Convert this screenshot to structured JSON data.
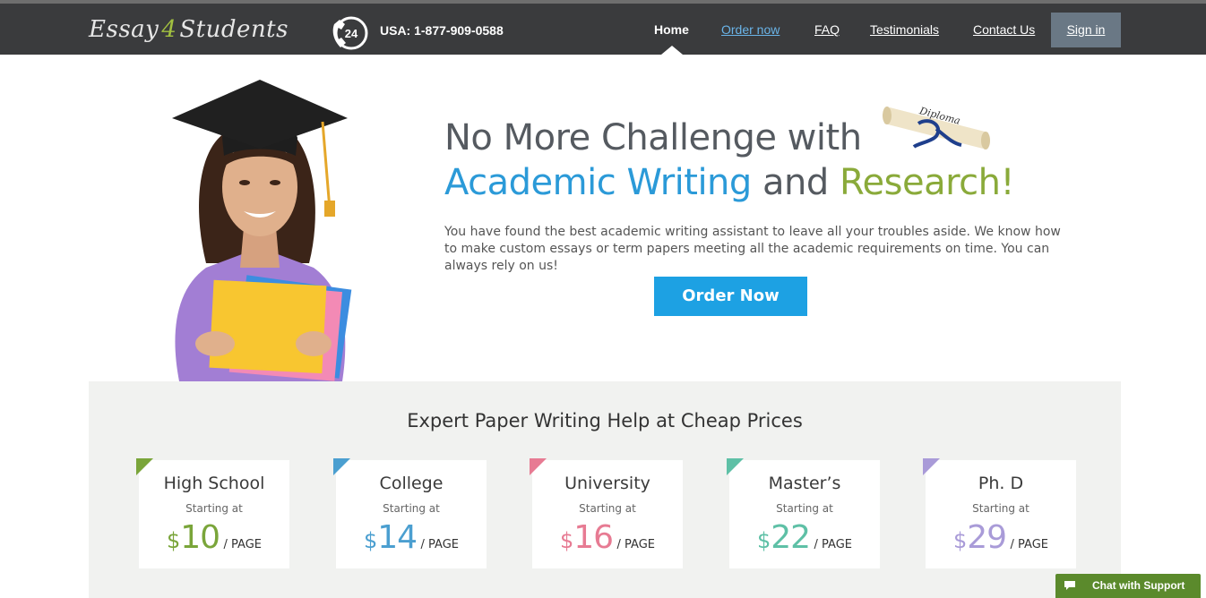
{
  "header": {
    "logo": {
      "part1": "Essay",
      "part2": "4",
      "part3": "Students"
    },
    "phone_badge": "24",
    "phone": "USA: 1-877-909-0588",
    "nav": {
      "home": "Home",
      "order": "Order now",
      "faq": "FAQ",
      "testimonials": "Testimonials",
      "contact": "Contact Us",
      "signin": "Sign in"
    }
  },
  "hero": {
    "line1": "No More Challenge with",
    "line2_a": "Academic Writing",
    "line2_b": "and",
    "line2_c": "Research!",
    "description": "You have found the best academic writing assistant to leave all your troubles aside. We know how to make custom essays or term papers meeting all the academic requirements on time. You can always rely on us!",
    "button": "Order Now",
    "diploma_text": "Diploma"
  },
  "pricing": {
    "title": "Expert Paper Writing Help at Cheap Prices",
    "cards": [
      {
        "title": "High School",
        "sub": "Starting at",
        "currency": "$",
        "price": "10",
        "unit": "/ PAGE",
        "color": "#7aa53a"
      },
      {
        "title": "College",
        "sub": "Starting at",
        "currency": "$",
        "price": "14",
        "unit": "/ PAGE",
        "color": "#4b9fd0"
      },
      {
        "title": "University",
        "sub": "Starting at",
        "currency": "$",
        "price": "16",
        "unit": "/ PAGE",
        "color": "#e77b93"
      },
      {
        "title": "Master’s",
        "sub": "Starting at",
        "currency": "$",
        "price": "22",
        "unit": "/ PAGE",
        "color": "#5ec0a6"
      },
      {
        "title": "Ph. D",
        "sub": "Starting at",
        "currency": "$",
        "price": "29",
        "unit": "/ PAGE",
        "color": "#a99bd8"
      }
    ]
  },
  "chat": {
    "label": "Chat with Support",
    "icon": "chat-bubble-icon"
  },
  "colors": {
    "navbar": "#3a3b3d",
    "accent_blue": "#2b9ad8",
    "accent_green": "#8aaa3a",
    "button": "#1da1e3",
    "chat": "#5b8a2c"
  }
}
